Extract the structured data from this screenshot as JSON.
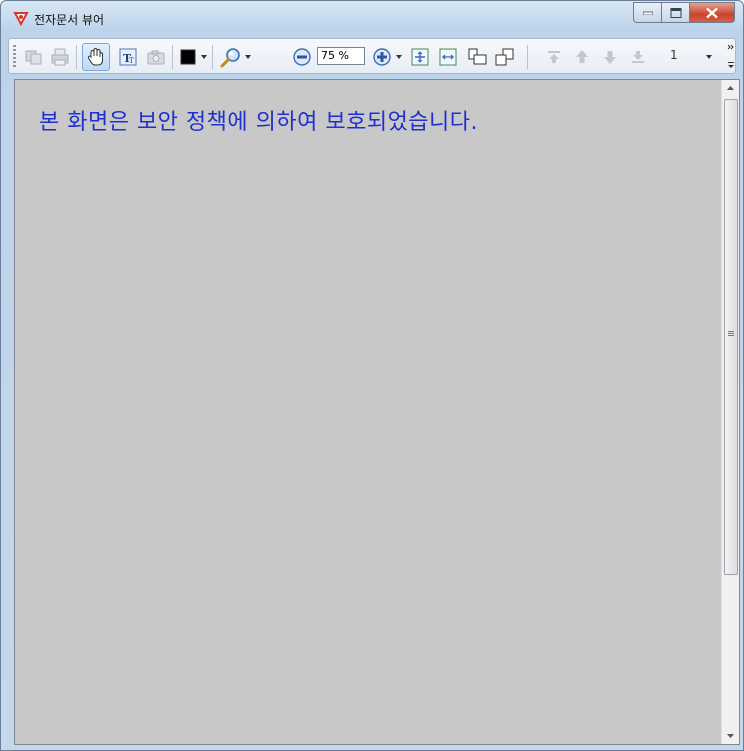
{
  "window": {
    "title": "전자문서 뷰어",
    "accent_color": "#bcd3ea",
    "close_color": "#c8442c"
  },
  "toolbar": {
    "icons": [
      "copy-icon",
      "print-icon",
      "hand-tool-icon",
      "text-select-icon",
      "snapshot-icon",
      "color-swatch-icon",
      "magnifier-icon",
      "zoom-out-icon",
      "zoom-in-icon",
      "fit-page-icon",
      "fit-width-icon",
      "rotate-left-icon",
      "rotate-right-icon",
      "first-page-icon",
      "previous-page-icon",
      "next-page-icon",
      "last-page-icon"
    ],
    "selected_color": "#000000",
    "zoom_value": "75 %",
    "page_number": "1"
  },
  "viewer": {
    "message": "본 화면은 보안 정책에 의하여 보호되었습니다.",
    "message_color": "#1f2fd0",
    "background_color": "#c8c8c8"
  }
}
